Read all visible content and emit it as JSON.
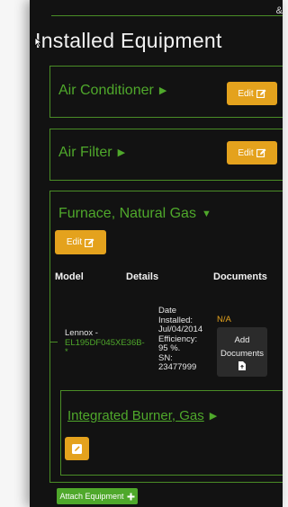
{
  "page": {
    "title": "Installed Equipment",
    "top_glyph": "&"
  },
  "equipment": [
    {
      "name": "Air Conditioner",
      "expanded": false,
      "edit_label": "Edit"
    },
    {
      "name": "Air Filter",
      "expanded": false,
      "edit_label": "Edit"
    },
    {
      "name": "Furnace, Natural Gas",
      "expanded": true,
      "edit_label": "Edit",
      "table": {
        "headers": [
          "Model",
          "Details",
          "Documents"
        ],
        "row": {
          "model_brand": "Lennox -",
          "model_number": "EL195DF045XE36B-",
          "model_suffix": "*",
          "details": [
            "Date",
            "Installed:",
            "Jul/04/2014",
            "Efficiency:",
            "95 %.",
            "SN:",
            "23477999"
          ],
          "documents_status": "N/A",
          "add_documents_label": [
            "Add",
            "Documents"
          ]
        }
      },
      "sub_component": {
        "name": "Integrated Burner, Gas",
        "expanded": false
      }
    }
  ],
  "attach_button_label": "Attach Equipment",
  "colors": {
    "accent_green": "#4fa82b",
    "border_green": "#4a8d26",
    "edit_orange": "#e4a21d",
    "background": "#121212"
  },
  "icons": [
    "edit-icon",
    "caret-right-icon",
    "caret-down-icon",
    "file-upload-icon",
    "plus-icon",
    "cursor-icon"
  ]
}
